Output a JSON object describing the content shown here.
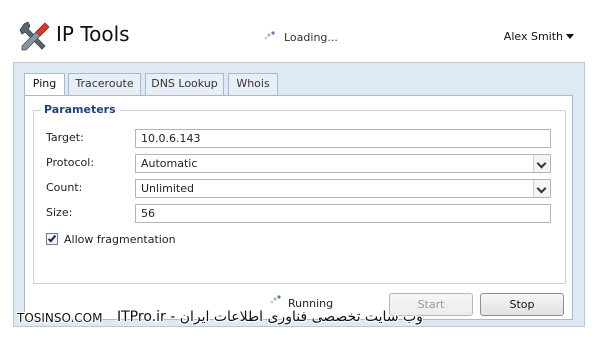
{
  "header": {
    "app_title": "IP Tools",
    "logo_icon": "tools-icon",
    "loading_label": "Loading...",
    "user_name": "Alex Smith"
  },
  "tabs": [
    {
      "label": "Ping",
      "active": true
    },
    {
      "label": "Traceroute",
      "active": false
    },
    {
      "label": "DNS Lookup",
      "active": false
    },
    {
      "label": "Whois",
      "active": false
    }
  ],
  "parameters": {
    "legend": "Parameters",
    "target_label": "Target:",
    "target_value": "10.0.6.143",
    "protocol_label": "Protocol:",
    "protocol_value": "Automatic",
    "count_label": "Count:",
    "count_value": "Unlimited",
    "size_label": "Size:",
    "size_value": "56",
    "allow_fragmentation_label": "Allow fragmentation",
    "allow_fragmentation_checked": true
  },
  "footer": {
    "status_label": "Running",
    "start_label": "Start",
    "start_enabled": false,
    "stop_label": "Stop"
  },
  "watermark": {
    "left_text": "TOSINSO.COM",
    "right_text": "ITPro.ir - وب سایت تخصصی فناوری اطلاعات ایران"
  },
  "colors": {
    "panel_background": "#dfe9f4",
    "border": "#a7b9cf",
    "legend_text": "#1f3f7a"
  }
}
